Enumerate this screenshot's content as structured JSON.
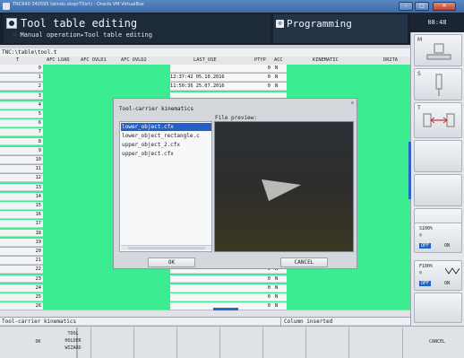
{
  "window": {
    "title": "TNC640 340595 (windu.skoprT0srt) - Oracle VM VirtualBox",
    "min": "–",
    "max": "□",
    "close": "✕"
  },
  "header": {
    "mode_title": "Tool table editing",
    "mode_breadcrumb": "Manual operation▸Tool table editing",
    "program_title": "Programming",
    "clock": "08:48"
  },
  "path": "TNC:\\table\\tool.t",
  "table": {
    "columns": [
      "T",
      "AFC LOAD",
      "AFC OVLD1",
      "AFC OVLD2",
      "LAST_USE",
      "PTYP",
      "ACC",
      "KINEMATIC",
      "DR2TA"
    ],
    "rows": [
      {
        "t": "0",
        "last_use": "",
        "ptyp": "0",
        "acc": "N"
      },
      {
        "t": "1",
        "last_use": "12:37:42 05.10.2016",
        "ptyp": "0",
        "acc": "N"
      },
      {
        "t": "2",
        "last_use": "11:50:36 25.07.2016",
        "ptyp": "0",
        "acc": "N"
      },
      {
        "t": "3",
        "last_use": "",
        "ptyp": "",
        "acc": ""
      },
      {
        "t": "4",
        "last_use": "",
        "ptyp": "",
        "acc": ""
      },
      {
        "t": "5",
        "last_use": "",
        "ptyp": "",
        "acc": ""
      },
      {
        "t": "6",
        "last_use": "",
        "ptyp": "",
        "acc": ""
      },
      {
        "t": "7",
        "last_use": "",
        "ptyp": "",
        "acc": ""
      },
      {
        "t": "8",
        "last_use": "",
        "ptyp": "",
        "acc": ""
      },
      {
        "t": "9",
        "last_use": "",
        "ptyp": "",
        "acc": ""
      },
      {
        "t": "10",
        "last_use": "",
        "ptyp": "",
        "acc": ""
      },
      {
        "t": "11",
        "last_use": "",
        "ptyp": "",
        "acc": ""
      },
      {
        "t": "12",
        "last_use": "",
        "ptyp": "",
        "acc": ""
      },
      {
        "t": "13",
        "last_use": "",
        "ptyp": "",
        "acc": ""
      },
      {
        "t": "14",
        "last_use": "",
        "ptyp": "",
        "acc": ""
      },
      {
        "t": "15",
        "last_use": "",
        "ptyp": "",
        "acc": ""
      },
      {
        "t": "16",
        "last_use": "",
        "ptyp": "",
        "acc": ""
      },
      {
        "t": "17",
        "last_use": "",
        "ptyp": "",
        "acc": ""
      },
      {
        "t": "18",
        "last_use": "",
        "ptyp": "",
        "acc": ""
      },
      {
        "t": "19",
        "last_use": "",
        "ptyp": "",
        "acc": ""
      },
      {
        "t": "20",
        "last_use": "",
        "ptyp": "",
        "acc": ""
      },
      {
        "t": "21",
        "last_use": "",
        "ptyp": "",
        "acc": ""
      },
      {
        "t": "22",
        "last_use": "",
        "ptyp": "0",
        "acc": "N"
      },
      {
        "t": "23",
        "last_use": "",
        "ptyp": "0",
        "acc": "N"
      },
      {
        "t": "24",
        "last_use": "",
        "ptyp": "0",
        "acc": "N"
      },
      {
        "t": "25",
        "last_use": "",
        "ptyp": "0",
        "acc": "N"
      },
      {
        "t": "26",
        "last_use": "",
        "ptyp": "0",
        "acc": "N"
      }
    ]
  },
  "status": {
    "left": "Tool-carrier kinematics",
    "right": "Column inserted"
  },
  "dialog": {
    "title": "Tool-carrier kinematics",
    "close": "x",
    "preview_label": "File preview:",
    "files": [
      "lower_object.cfx",
      "lower_object_rectangle.c",
      "upper_object_2.cfx",
      "upper_object.cfx"
    ],
    "selected_index": 0,
    "ok": "OK",
    "cancel": "CANCEL"
  },
  "softkeys": {
    "ok": "OK",
    "tool_holder_wizard": [
      "TOOL",
      "HOLDER",
      "WIZARD"
    ],
    "cancel": "CANCEL"
  },
  "sidebar": {
    "btn1": "M",
    "btn2": "S",
    "btn3": "T",
    "s_override": "S100%",
    "f_override": "F100%",
    "off": "OFF",
    "on": "ON"
  },
  "colors": {
    "table_green": "#3cec91",
    "selection_blue": "#2460c8",
    "header_dark": "#17212e"
  }
}
